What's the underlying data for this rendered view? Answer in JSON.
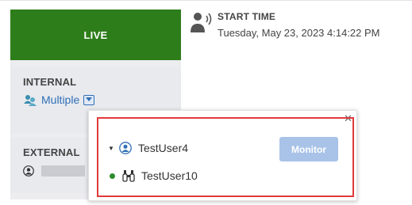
{
  "status": {
    "live_label": "LIVE"
  },
  "internal": {
    "heading": "INTERNAL",
    "participants_label": "Multiple"
  },
  "external": {
    "heading": "EXTERNAL"
  },
  "start_time": {
    "heading": "START TIME",
    "value": "Tuesday, May 23, 2023 4:14:22 PM"
  },
  "participants_popup": {
    "close_glyph": "✕",
    "users": [
      {
        "name": "TestUser4",
        "icon": "user-circle-icon",
        "expanded": true
      },
      {
        "name": "TestUser10",
        "icon": "binoculars-icon",
        "online": true
      }
    ],
    "monitor_label": "Monitor"
  },
  "colors": {
    "live_green": "#2e7d1b",
    "link_blue": "#2f6fb6",
    "monitor_disabled": "#a9c3e8",
    "highlight_red": "#e03a3a",
    "online_green": "#2e8b2e"
  }
}
